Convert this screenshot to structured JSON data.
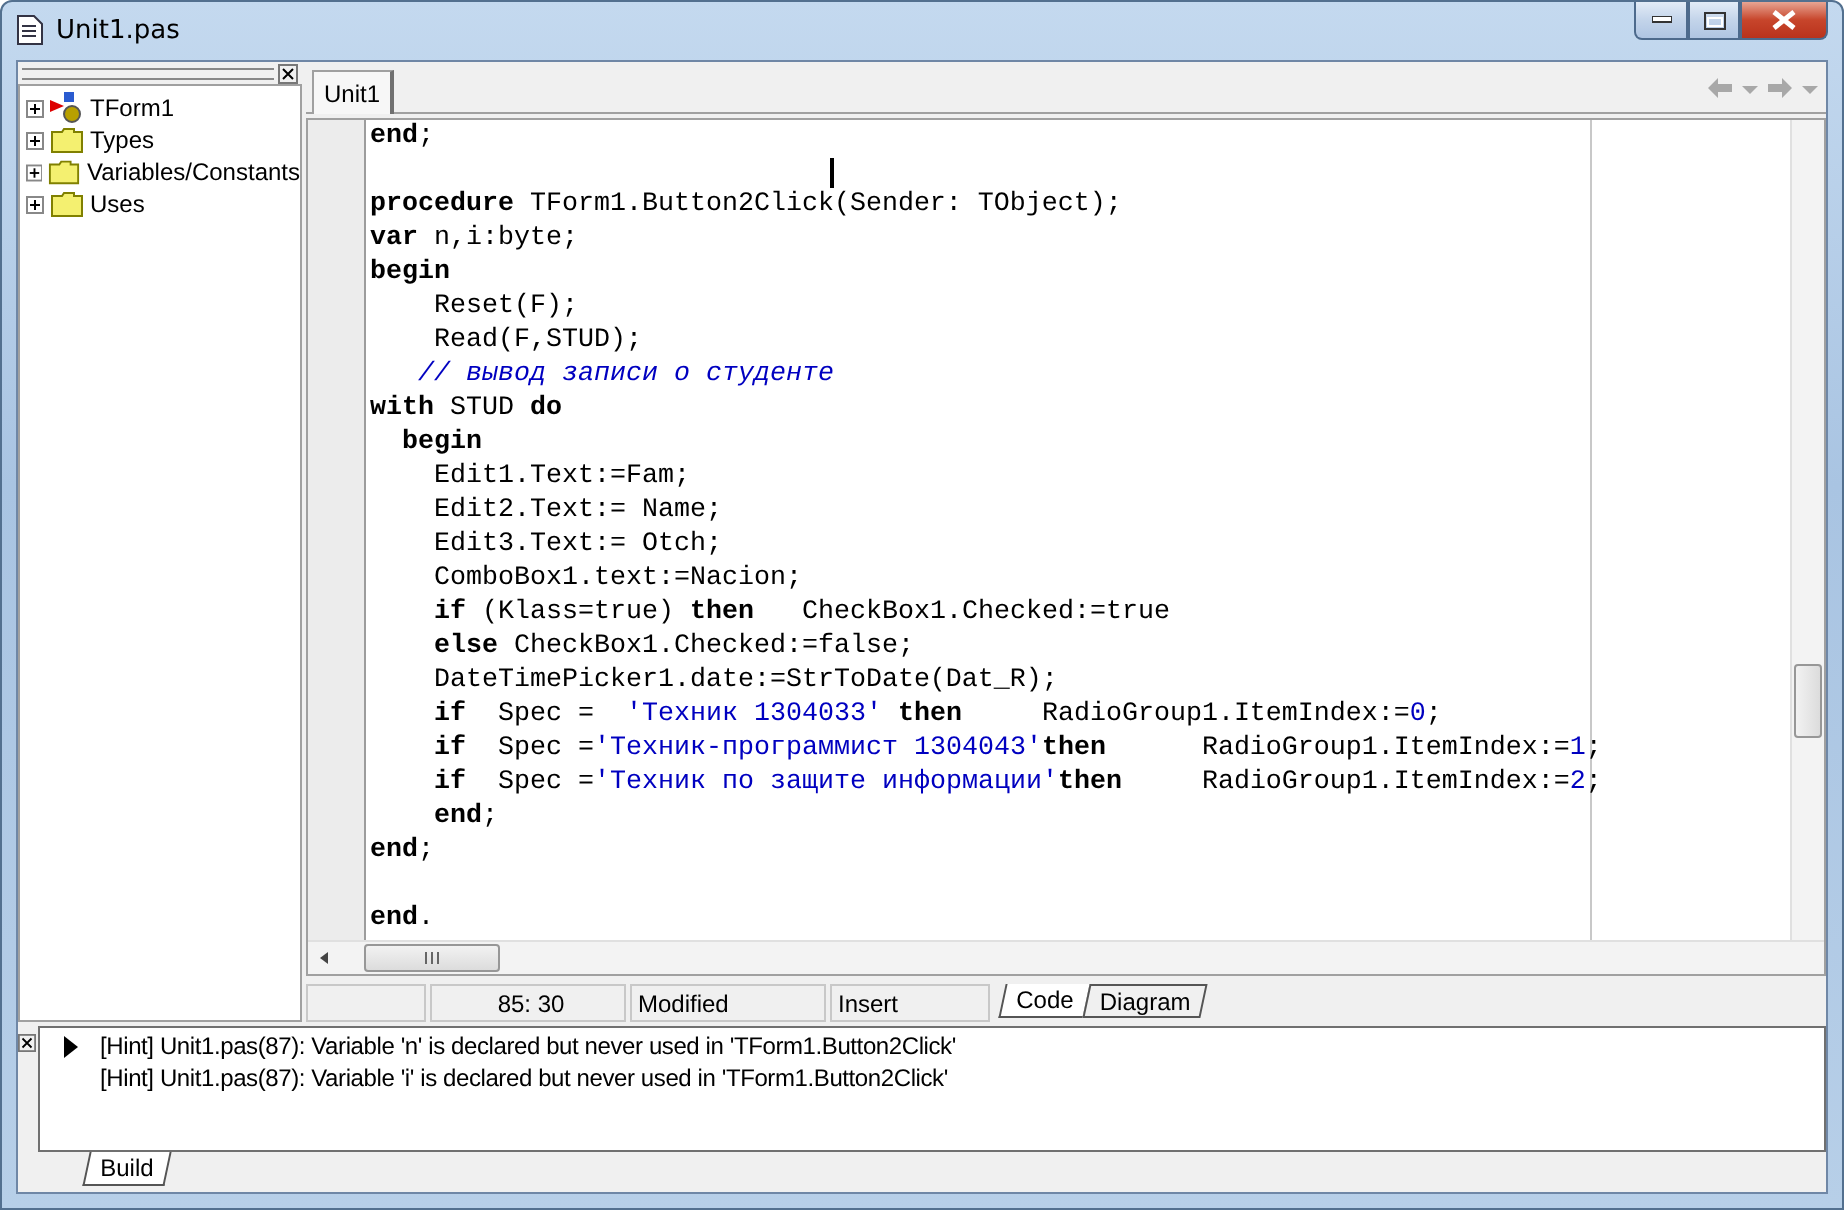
{
  "window": {
    "title": "Unit1.pas"
  },
  "explorer": {
    "items": [
      {
        "label": "TForm1",
        "kind": "class",
        "expanded": false
      },
      {
        "label": "Types",
        "kind": "folder",
        "expanded": false
      },
      {
        "label": "Variables/Constants",
        "kind": "folder",
        "expanded": false
      },
      {
        "label": "Uses",
        "kind": "folder",
        "expanded": false
      }
    ]
  },
  "editor": {
    "tabs": [
      {
        "label": "Unit1",
        "selected": true
      }
    ],
    "lines": [
      {
        "kind": "code",
        "tokens": [
          {
            "kind": "kw",
            "text": "end"
          },
          {
            "kind": "txt",
            "text": ";"
          }
        ]
      },
      {
        "kind": "blank"
      },
      {
        "kind": "code",
        "tokens": [
          {
            "kind": "kw",
            "text": "procedure"
          },
          {
            "kind": "txt",
            "text": " TForm1.Button2Click(Sender: TObject);"
          }
        ]
      },
      {
        "kind": "code",
        "tokens": [
          {
            "kind": "kw",
            "text": "var"
          },
          {
            "kind": "txt",
            "text": " n,i:byte;"
          }
        ]
      },
      {
        "kind": "code",
        "tokens": [
          {
            "kind": "kw",
            "text": "begin"
          }
        ]
      },
      {
        "kind": "code",
        "tokens": [
          {
            "kind": "txt",
            "text": "    Reset(F);"
          }
        ]
      },
      {
        "kind": "code",
        "tokens": [
          {
            "kind": "txt",
            "text": "    Read(F,STUD);"
          }
        ]
      },
      {
        "kind": "code",
        "tokens": [
          {
            "kind": "cmt",
            "text": "   // вывод записи о студенте"
          }
        ]
      },
      {
        "kind": "code",
        "tokens": [
          {
            "kind": "kw",
            "text": "with"
          },
          {
            "kind": "txt",
            "text": " STUD "
          },
          {
            "kind": "kw",
            "text": "do"
          }
        ]
      },
      {
        "kind": "code",
        "tokens": [
          {
            "kind": "kw",
            "text": "  begin"
          }
        ]
      },
      {
        "kind": "code",
        "tokens": [
          {
            "kind": "txt",
            "text": "    Edit1.Text:=Fam;"
          }
        ]
      },
      {
        "kind": "code",
        "tokens": [
          {
            "kind": "txt",
            "text": "    Edit2.Text:= Name;"
          }
        ]
      },
      {
        "kind": "code",
        "tokens": [
          {
            "kind": "txt",
            "text": "    Edit3.Text:= Otch;"
          }
        ]
      },
      {
        "kind": "code",
        "tokens": [
          {
            "kind": "txt",
            "text": "    ComboBox1.text:=Nacion;"
          }
        ]
      },
      {
        "kind": "code",
        "tokens": [
          {
            "kind": "kw",
            "text": "    if"
          },
          {
            "kind": "txt",
            "text": " (Klass=true) "
          },
          {
            "kind": "kw",
            "text": "then"
          },
          {
            "kind": "txt",
            "text": "   CheckBox1.Checked:=true"
          }
        ]
      },
      {
        "kind": "code",
        "tokens": [
          {
            "kind": "kw",
            "text": "    else"
          },
          {
            "kind": "txt",
            "text": " CheckBox1.Checked:=false;"
          }
        ]
      },
      {
        "kind": "code",
        "tokens": [
          {
            "kind": "txt",
            "text": "    DateTimePicker1.date:=StrToDate(Dat_R);"
          }
        ]
      },
      {
        "kind": "code",
        "tokens": [
          {
            "kind": "kw",
            "text": "    if"
          },
          {
            "kind": "txt",
            "text": "  Spec =  "
          },
          {
            "kind": "str",
            "text": "'Техник 1304033'"
          },
          {
            "kind": "kw",
            "text": " then"
          },
          {
            "kind": "txt",
            "text": "     RadioGroup1.ItemIndex:="
          },
          {
            "kind": "num",
            "text": "0"
          },
          {
            "kind": "txt",
            "text": ";"
          }
        ]
      },
      {
        "kind": "code",
        "tokens": [
          {
            "kind": "kw",
            "text": "    if"
          },
          {
            "kind": "txt",
            "text": "  Spec ="
          },
          {
            "kind": "str",
            "text": "'Техник-программист 1304043'"
          },
          {
            "kind": "kw",
            "text": "then"
          },
          {
            "kind": "txt",
            "text": "      RadioGroup1.ItemIndex:="
          },
          {
            "kind": "num",
            "text": "1"
          },
          {
            "kind": "txt",
            "text": ";"
          }
        ]
      },
      {
        "kind": "code",
        "tokens": [
          {
            "kind": "kw",
            "text": "    if"
          },
          {
            "kind": "txt",
            "text": "  Spec ="
          },
          {
            "kind": "str",
            "text": "'Техник по защите информации'"
          },
          {
            "kind": "kw",
            "text": "then"
          },
          {
            "kind": "txt",
            "text": "     RadioGroup1.ItemIndex:="
          },
          {
            "kind": "num",
            "text": "2"
          },
          {
            "kind": "txt",
            "text": ";"
          }
        ]
      },
      {
        "kind": "code",
        "tokens": [
          {
            "kind": "kw",
            "text": "    end"
          },
          {
            "kind": "txt",
            "text": ";"
          }
        ]
      },
      {
        "kind": "code",
        "tokens": [
          {
            "kind": "kw",
            "text": "end"
          },
          {
            "kind": "txt",
            "text": ";"
          }
        ]
      },
      {
        "kind": "blank"
      },
      {
        "kind": "code",
        "tokens": [
          {
            "kind": "kw",
            "text": "end"
          },
          {
            "kind": "txt",
            "text": "."
          }
        ]
      }
    ]
  },
  "status_bar": {
    "position": "85:  30",
    "state": "Modified",
    "mode": "Insert",
    "tabs": [
      {
        "label": "Code",
        "selected": true
      },
      {
        "label": "Diagram",
        "selected": false
      }
    ]
  },
  "messages": {
    "items": [
      {
        "text": "[Hint] Unit1.pas(87): Variable 'n' is declared but never used in 'TForm1.Button2Click'",
        "selected": true
      },
      {
        "text": "[Hint] Unit1.pas(87): Variable 'i' is declared but never used in 'TForm1.Button2Click'",
        "selected": false
      }
    ],
    "tabs": [
      {
        "label": "Build",
        "selected": true
      }
    ]
  }
}
